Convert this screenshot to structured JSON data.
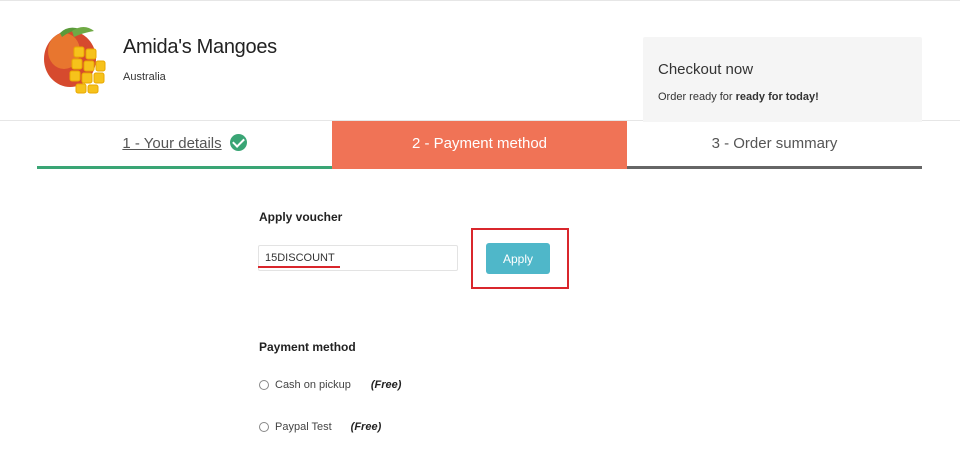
{
  "store": {
    "name": "Amida's Mangoes",
    "country": "Australia"
  },
  "checkout": {
    "title": "Checkout now",
    "text_prefix": "Order ready for",
    "text_bold": "ready for today!"
  },
  "steps": [
    {
      "label": "1 - Your details",
      "status": "completed"
    },
    {
      "label": "2 - Payment method",
      "status": "active"
    },
    {
      "label": "3 - Order summary",
      "status": "pending"
    }
  ],
  "voucher": {
    "title": "Apply voucher",
    "value": "15DISCOUNT",
    "apply_label": "Apply"
  },
  "payment": {
    "title": "Payment method",
    "options": [
      {
        "label": "Cash on pickup",
        "fee": "(Free)"
      },
      {
        "label": "Paypal Test",
        "fee": "(Free)"
      }
    ]
  },
  "colors": {
    "accent_green": "#3aa575",
    "active_step": "#f07356",
    "apply_button": "#4fb7c9",
    "highlight": "#d9262c"
  }
}
